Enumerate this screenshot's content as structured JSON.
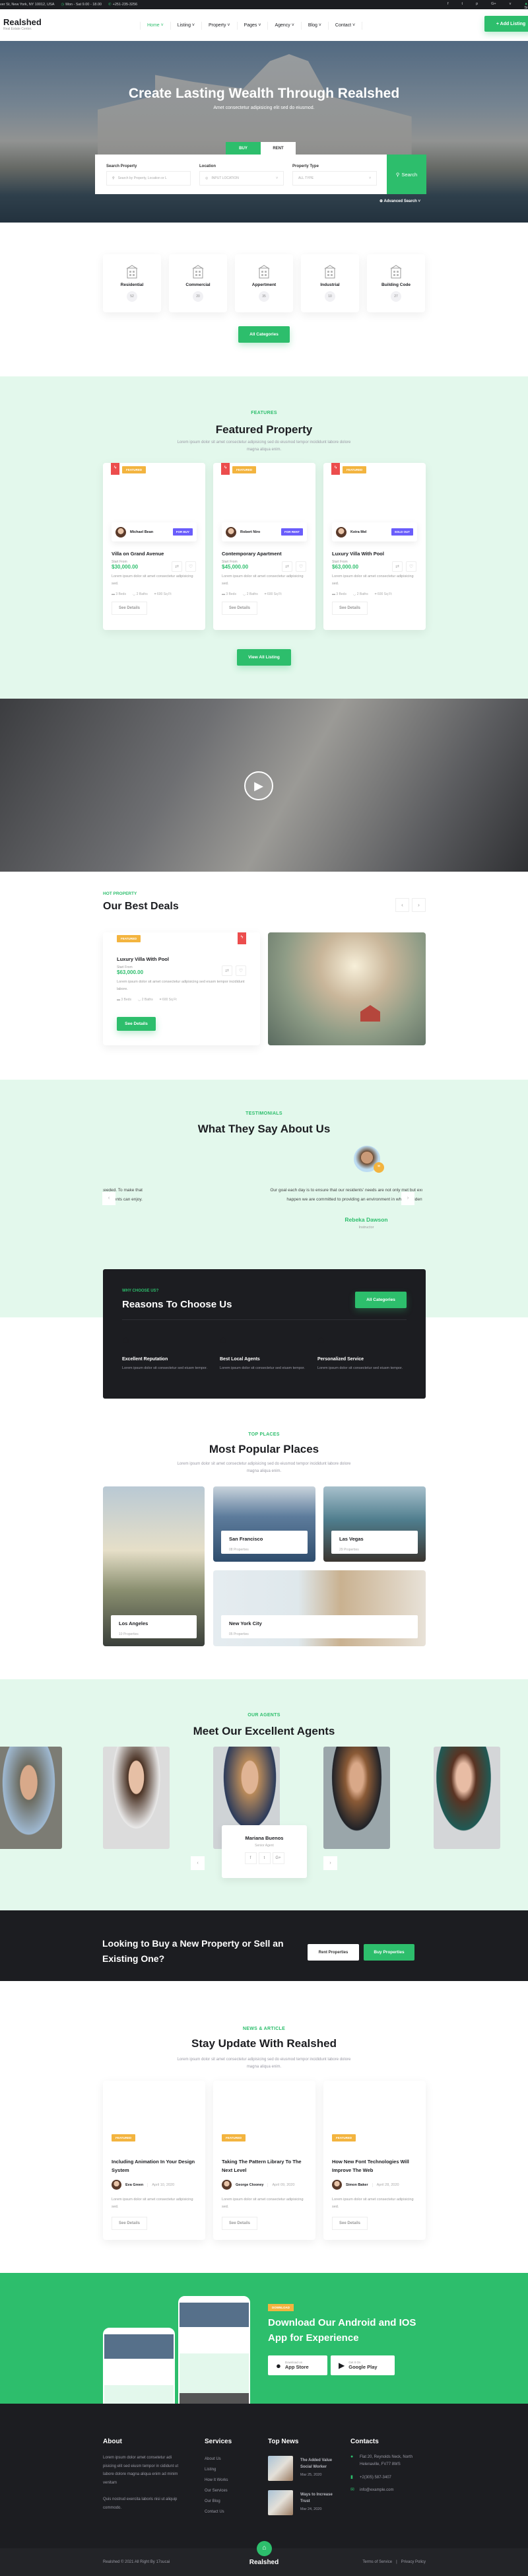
{
  "topbar": {
    "address": "ver St, New York, NY 10012, USA",
    "hours": "Mon - Sat 9.00 - 18.00",
    "phone": "+251-235-3256",
    "social": [
      "f",
      "t",
      "p",
      "G+",
      "v"
    ],
    "signin": "Si"
  },
  "header": {
    "logo": "Realshed",
    "tagline": "Real Estate Center.",
    "nav": [
      "Home",
      "Listing",
      "Property",
      "Pages",
      "Agency",
      "Blog",
      "Contact"
    ],
    "add_listing": "+ Add Listing"
  },
  "hero": {
    "title": "Create Lasting Wealth Through Realshed",
    "subtitle": "Amet consectetur adipisicing elit sed do eiusmod.",
    "tabs": [
      "BUY",
      "RENT"
    ],
    "active_tab": "BUY",
    "search_label": "Search Property",
    "search_placeholder": "Search by Property, Location or L",
    "location_label": "Location",
    "location_value": "INPUT LOCATION",
    "type_label": "Property Type",
    "type_value": "ALL TYPE",
    "search_button": "Search",
    "advanced": "Advanced Search"
  },
  "categories": {
    "items": [
      {
        "name": "Residential",
        "count": "52"
      },
      {
        "name": "Commercial",
        "count": "20"
      },
      {
        "name": "Appertment",
        "count": "35"
      },
      {
        "name": "Industrial",
        "count": "10"
      },
      {
        "name": "Building Code",
        "count": "27"
      }
    ],
    "button": "All Categories"
  },
  "featured": {
    "label": "FEATURES",
    "title": "Featured Property",
    "desc": "Lorem ipsum dolor sit amet consectetur adipisicing sed do eiusmod tempor incididunt labore dolore magna aliqua enim.",
    "cards": [
      {
        "tag": "FEATURED",
        "agent": "Michael Bean",
        "badge": "FOR BUY",
        "title": "Villa on Grand Avenue",
        "start": "Start From",
        "price": "$30,000.00",
        "text": "Lorem ipsum dolor sit amet consectetur adipisicing sed.",
        "beds": "3 Beds",
        "baths": "2 Baths",
        "area": "600 Sq Ft",
        "details": "See Details"
      },
      {
        "tag": "FEATURED",
        "agent": "Robert Niro",
        "badge": "FOR RENT",
        "title": "Contemporary Apartment",
        "start": "Start From",
        "price": "$45,000.00",
        "text": "Lorem ipsum dolor sit amet consectetur adipisicing sed.",
        "beds": "3 Beds",
        "baths": "2 Baths",
        "area": "600 Sq Ft",
        "details": "See Details"
      },
      {
        "tag": "FEATURED",
        "agent": "Keira Mel",
        "badge": "SOLD OUT",
        "title": "Luxury Villa With Pool",
        "start": "Start From",
        "price": "$63,000.00",
        "text": "Lorem ipsum dolor sit amet consectetur adipisicing sed.",
        "beds": "3 Beds",
        "baths": "2 Baths",
        "area": "600 Sq Ft",
        "details": "See Details"
      }
    ],
    "button": "View All Listing"
  },
  "deals": {
    "label": "HOT PROPERTY",
    "title": "Our Best Deals",
    "tag": "FEATURED",
    "name": "Luxury Villa With Pool",
    "start": "Start From",
    "price": "$63,000.00",
    "text": "Lorem ipsum dolor sit amet consectetur adipisicing sed eiusm tempor incididunt labore.",
    "beds": "3 Beds",
    "baths": "2 Baths",
    "area": "600 Sq Ft",
    "button": "See Details"
  },
  "testimonials": {
    "label": "TESTIMONIALS",
    "title": "What They Say About Us",
    "quote": "Our goal each day is to ensure that our residents' needs are not only met but exceeded. To make that happen we are committed to providing an environment in which residents can enjoy.",
    "name": "Rebeka Dawson",
    "role": "Instructor"
  },
  "reasons": {
    "label": "WHY CHOOSE US?",
    "title": "Reasons To Choose Us",
    "button": "All Categories",
    "items": [
      {
        "title": "Excellent Reputation",
        "text": "Lorem ipsum dolor sit consectetur sed eiusm tempor.",
        "color": "#f3b43f"
      },
      {
        "title": "Best Local Agents",
        "text": "Lorem ipsum dolor sit consectetur sed eiusm tempor.",
        "color": "#2dbe6c"
      },
      {
        "title": "Personalized Service",
        "text": "Lorem ipsum dolor sit consectetur sed eiusm tempor.",
        "color": "#ec4d4d"
      }
    ]
  },
  "places": {
    "label": "TOP PLACES",
    "title": "Most Popular Places",
    "desc": "Lorem ipsum dolor sit amet consectetur adipisicing sed do eiusmod tempor incididunt labore dolore magna aliqua enim.",
    "items": [
      {
        "name": "Los Angeles",
        "count": "10 Properties"
      },
      {
        "name": "San Francisco",
        "count": "08 Properties"
      },
      {
        "name": "Las Vegas",
        "count": "29 Properties"
      },
      {
        "name": "New York City",
        "count": "05 Properties"
      }
    ]
  },
  "agents": {
    "label": "OUR AGENTS",
    "title": "Meet Our Excellent Agents",
    "featured_name": "Mariana Buenos",
    "featured_role": "Senior Agent",
    "social": [
      "f",
      "t",
      "G+"
    ]
  },
  "cta": {
    "title": "Looking to Buy a New Property or Sell an Existing One?",
    "rent": "Rent Properties",
    "buy": "Buy Properties"
  },
  "blog": {
    "label": "NEWS & ARTICLE",
    "title": "Stay Update With Realshed",
    "desc": "Lorem ipsum dolor sit amet consectetur adipisicing sed do eiusmod tempor incididunt labore dolore magna aliqua enim.",
    "posts": [
      {
        "tag": "FEATURED",
        "title": "Including Animation In Your Design System",
        "author": "Eva Green",
        "date": "April 10, 2020",
        "text": "Lorem ipsum dolor sit amet consectetur adipisicing sed.",
        "button": "See Details"
      },
      {
        "tag": "FEATURED",
        "title": "Taking The Pattern Library To The Next Level",
        "author": "George Clooney",
        "date": "April 09, 2020",
        "text": "Lorem ipsum dolor sit amet consectetur adipisicing sed.",
        "button": "See Details"
      },
      {
        "tag": "FEATURED",
        "title": "How New Font Technologies Will Improve The Web",
        "author": "Simon Baker",
        "date": "April 28, 2020",
        "text": "Lorem ipsum dolor sit amet consectetur adipisicing sed.",
        "button": "See Details"
      }
    ]
  },
  "app": {
    "badge": "DOWNLOAD",
    "title": "Download Our Android and IOS App for Experience",
    "appstore_small": "Download on",
    "appstore": "App Store",
    "gplay_small": "Get It On",
    "gplay": "Google Play"
  },
  "footer": {
    "about_title": "About",
    "about_text1": "Lorem ipsum dolor amet consetetur adi pisicing elit sed eiusm tempor in cididunt ut labore dolore magna aliqua enim ad minim venitam",
    "about_text2": "Quis nostrud exercita laboris nisi ut aliquip commodo.",
    "services_title": "Services",
    "services": [
      "About Us",
      "Listing",
      "How It Works",
      "Our Services",
      "Our Blog",
      "Contact Us"
    ],
    "news_title": "Top News",
    "news": [
      {
        "title": "The Added Value Social Worker",
        "date": "Mar 25, 2020"
      },
      {
        "title": "Ways to Increase Trust",
        "date": "Mar 24, 2020"
      }
    ],
    "contacts_title": "Contacts",
    "address": "Flat 20, Reynolds Neck, North Helenaville, FV77 8WS",
    "phone": "+2(305) 587-3407",
    "email": "info@example.com",
    "copyright": "Realshed © 2021 All Right By 17sucai",
    "logo": "Realshed",
    "terms": "Terms of Service",
    "privacy": "Privacy Policy"
  },
  "colors": {
    "accent": "#2dbe6c",
    "dark": "#1c1d21",
    "mint": "#e3f8ec",
    "featured": "#f3b43f",
    "badge": "#6a5dfb",
    "hot": "#ec4d4d"
  }
}
